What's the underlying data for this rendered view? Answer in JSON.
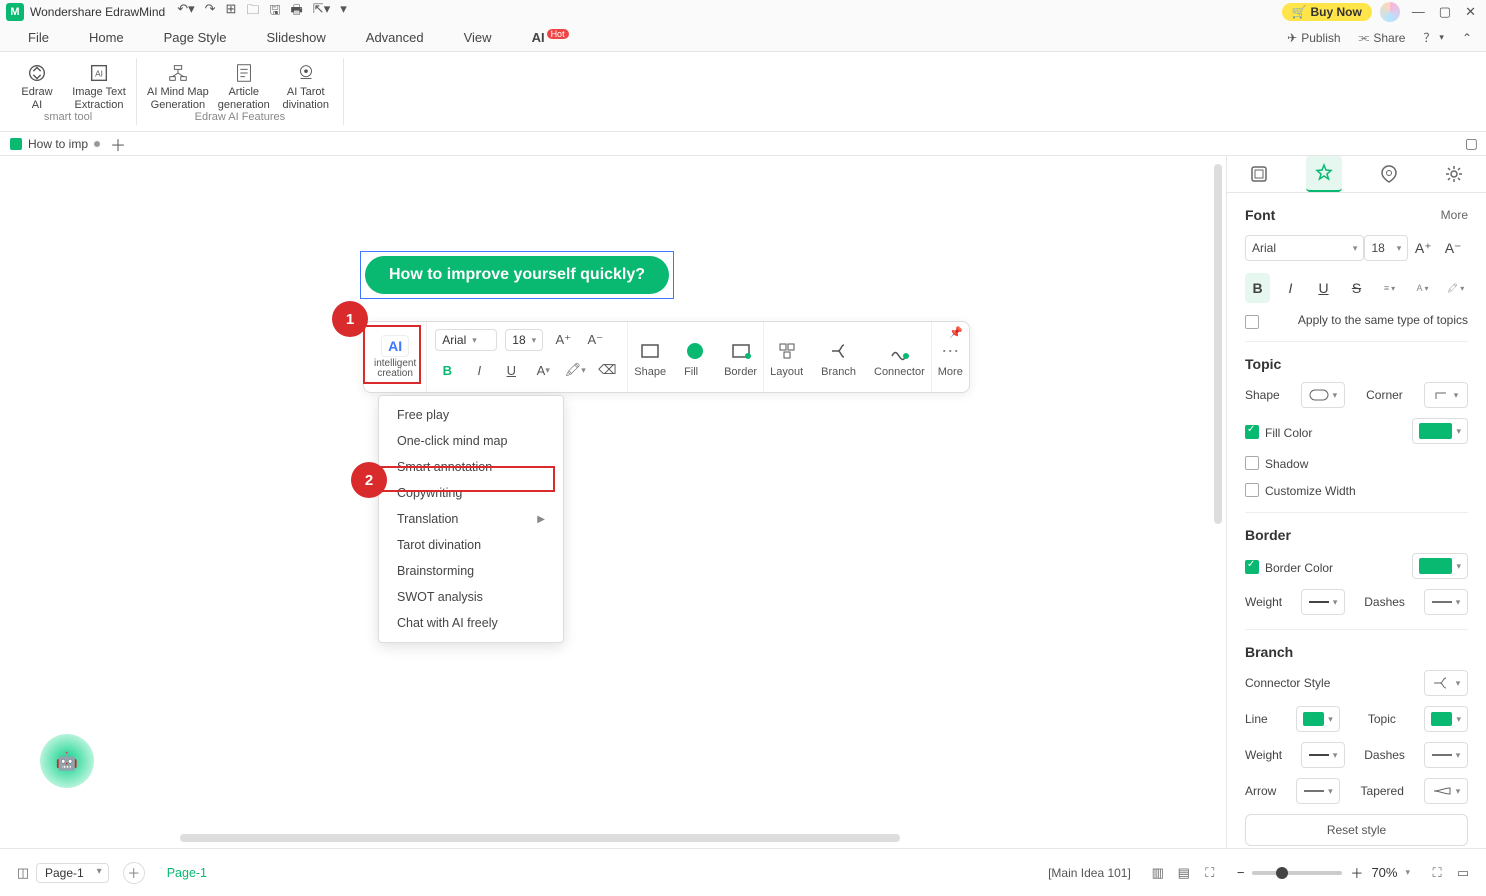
{
  "app": {
    "name": "Wondershare EdrawMind",
    "buy": "Buy Now"
  },
  "menu": {
    "tabs": [
      "File",
      "Home",
      "Page Style",
      "Slideshow",
      "Advanced",
      "View"
    ],
    "ai_tab": "AI",
    "hot": "Hot",
    "publish": "Publish",
    "share": "Share"
  },
  "ribbon": {
    "group1": {
      "label": "smart tool",
      "items": [
        {
          "line1": "Edraw",
          "line2": "AI"
        },
        {
          "line1": "Image Text",
          "line2": "Extraction"
        }
      ]
    },
    "group2": {
      "label": "Edraw AI Features",
      "items": [
        {
          "line1": "AI Mind Map",
          "line2": "Generation"
        },
        {
          "line1": "Article",
          "line2": "generation"
        },
        {
          "line1": "AI Tarot",
          "line2": "divination"
        }
      ]
    }
  },
  "doctab": {
    "name": "How to imp"
  },
  "topic_text": "How to improve yourself quickly?",
  "floatbar": {
    "ai_icon": "AI",
    "ai_label1": "intelligent",
    "ai_label2": "creation",
    "font": "Arial",
    "size": "18",
    "labels": {
      "shape": "Shape",
      "fill": "Fill",
      "border": "Border",
      "layout": "Layout",
      "branch": "Branch",
      "connector": "Connector",
      "more": "More"
    }
  },
  "dropdown": [
    "Free play",
    "One-click mind map",
    "Smart annotation",
    "Copywriting",
    "Translation",
    "Tarot divination",
    "Brainstorming",
    "SWOT analysis",
    "Chat with AI freely"
  ],
  "callouts": {
    "one": "1",
    "two": "2"
  },
  "panel": {
    "font_head": "Font",
    "more": "More",
    "font_name": "Arial",
    "font_size": "18",
    "apply_same": "Apply to the same type of topics",
    "topic_head": "Topic",
    "shape": "Shape",
    "corner": "Corner",
    "fill_color": "Fill Color",
    "shadow": "Shadow",
    "custom_width": "Customize Width",
    "border_head": "Border",
    "border_color": "Border Color",
    "weight": "Weight",
    "dashes": "Dashes",
    "branch_head": "Branch",
    "conn_style": "Connector Style",
    "line": "Line",
    "topic": "Topic",
    "arrow": "Arrow",
    "tapered": "Tapered",
    "reset": "Reset style",
    "green": "#09b871"
  },
  "status": {
    "page_selected": "Page-1",
    "active_page": "Page-1",
    "info": "[Main Idea 101]",
    "zoom_pct": "70%"
  }
}
